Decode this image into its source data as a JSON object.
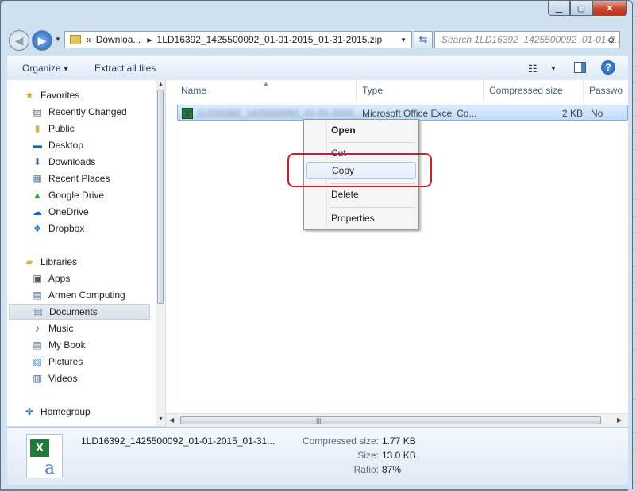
{
  "window": {
    "caption_min": "▁",
    "caption_max": "▢",
    "caption_close": "✕"
  },
  "address_bar": {
    "prefix": "«",
    "crumb_1": "Downloa...",
    "crumb_2": "1LD16392_1425500092_01-01-2015_01-31-2015.zip",
    "search_placeholder": "Search 1LD16392_1425500092_01-01-2..."
  },
  "toolbar": {
    "organize_label": "Organize ▾",
    "extract_label": "Extract all files"
  },
  "nav": {
    "favorites_header": "Favorites",
    "favorites": [
      {
        "label": "Recently Changed",
        "icon": "recent-changes-icon"
      },
      {
        "label": "Public",
        "icon": "folder-icon"
      },
      {
        "label": "Desktop",
        "icon": "desktop-icon"
      },
      {
        "label": "Downloads",
        "icon": "downloads-icon"
      },
      {
        "label": "Recent Places",
        "icon": "recent-places-icon"
      },
      {
        "label": "Google Drive",
        "icon": "google-drive-icon"
      },
      {
        "label": "OneDrive",
        "icon": "onedrive-icon"
      },
      {
        "label": "Dropbox",
        "icon": "dropbox-icon"
      }
    ],
    "libraries_header": "Libraries",
    "libraries": [
      {
        "label": "Apps",
        "icon": "apps-icon"
      },
      {
        "label": "Armen Computing",
        "icon": "library-icon"
      },
      {
        "label": "Documents",
        "icon": "documents-icon",
        "selected": true
      },
      {
        "label": "Music",
        "icon": "music-icon"
      },
      {
        "label": "My Book",
        "icon": "library-icon"
      },
      {
        "label": "Pictures",
        "icon": "pictures-icon"
      },
      {
        "label": "Videos",
        "icon": "videos-icon"
      }
    ],
    "homegroup": "Homegroup"
  },
  "columns": {
    "name": "Name",
    "type": "Type",
    "compressed_size": "Compressed size",
    "password": "Passwo"
  },
  "file": {
    "name": "1LD16392_1425500092_01-01-2015_...",
    "type": "Microsoft Office Excel Co...",
    "compressed_size": "2 KB",
    "password": "No"
  },
  "context_menu": {
    "open": "Open",
    "cut": "Cut",
    "copy": "Copy",
    "delete": "Delete",
    "properties": "Properties"
  },
  "details": {
    "file_name": "1LD16392_1425500092_01-01-2015_01-31...",
    "compressed_size_label": "Compressed size:",
    "compressed_size_value": "1.77 KB",
    "size_label": "Size:",
    "size_value": "13.0 KB",
    "ratio_label": "Ratio:",
    "ratio_value": "87%"
  },
  "colors": {
    "highlight": "#d8191f",
    "selection": "#c1dcfc"
  }
}
